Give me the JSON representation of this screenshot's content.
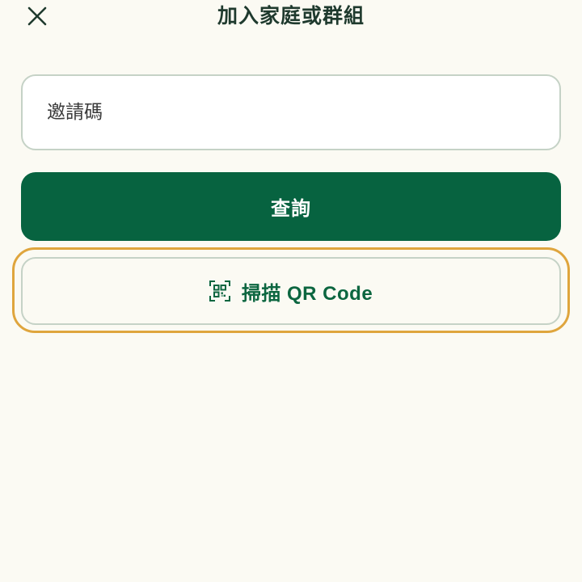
{
  "header": {
    "title": "加入家庭或群組",
    "close_icon": "close-icon"
  },
  "invite": {
    "placeholder": "邀請碼",
    "value": ""
  },
  "query_button": {
    "label": "查詢"
  },
  "scan_button": {
    "label": "掃描 QR Code",
    "icon": "qr-code-scan-icon"
  },
  "colors": {
    "background": "#fbfaf3",
    "primary": "#076340",
    "title_text": "#1f3a2e",
    "input_border": "#c5d2c6",
    "focus_ring": "#dfa53d"
  }
}
